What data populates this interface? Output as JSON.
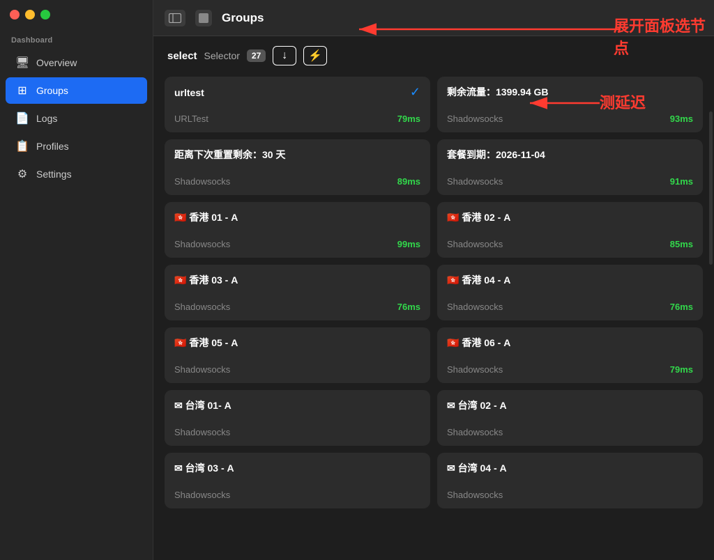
{
  "window": {
    "title": "Groups"
  },
  "traffic_lights": {
    "red": "red",
    "yellow": "yellow",
    "green": "green"
  },
  "sidebar": {
    "section_label": "Dashboard",
    "items": [
      {
        "id": "overview",
        "label": "Overview",
        "icon": "🖥",
        "active": false
      },
      {
        "id": "groups",
        "label": "Groups",
        "icon": "⊞",
        "active": true
      },
      {
        "id": "logs",
        "label": "Logs",
        "icon": "📄",
        "active": false
      },
      {
        "id": "profiles",
        "label": "Profiles",
        "icon": "📋",
        "active": false
      },
      {
        "id": "settings",
        "label": "Settings",
        "icon": "⚙",
        "active": false
      }
    ]
  },
  "titlebar": {
    "title": "Groups",
    "panel_icon": "⊞",
    "square_icon": "■"
  },
  "toolbar": {
    "select_label": "select",
    "selector_label": "Selector",
    "badge_count": "27",
    "download_btn_label": "↓",
    "lightning_btn_label": "⚡"
  },
  "annotations": {
    "panel_text": "展开面板选节点",
    "latency_text": "测延迟"
  },
  "nodes": [
    {
      "id": "node-urltest",
      "name": "urltest",
      "type": "URLTest",
      "latency": "79ms",
      "latency_color": "green",
      "selected": true,
      "flag": ""
    },
    {
      "id": "node-traffic",
      "name": "剩余流量：1399.94 GB",
      "type": "Shadowsocks",
      "latency": "93ms",
      "latency_color": "green",
      "selected": false,
      "flag": ""
    },
    {
      "id": "node-days",
      "name": "距离下次重置剩余：30 天",
      "type": "Shadowsocks",
      "latency": "89ms",
      "latency_color": "green",
      "selected": false,
      "flag": ""
    },
    {
      "id": "node-expire",
      "name": "套餐到期：2026-11-04",
      "type": "Shadowsocks",
      "latency": "91ms",
      "latency_color": "green",
      "selected": false,
      "flag": ""
    },
    {
      "id": "node-hk01",
      "name": "🇭🇰 香港 01 - A",
      "type": "Shadowsocks",
      "latency": "99ms",
      "latency_color": "green",
      "selected": false,
      "flag": "hk"
    },
    {
      "id": "node-hk02",
      "name": "🇭🇰 香港 02 - A",
      "type": "Shadowsocks",
      "latency": "85ms",
      "latency_color": "green",
      "selected": false,
      "flag": "hk"
    },
    {
      "id": "node-hk03",
      "name": "🇭🇰 香港 03 - A",
      "type": "Shadowsocks",
      "latency": "76ms",
      "latency_color": "green",
      "selected": false,
      "flag": "hk"
    },
    {
      "id": "node-hk04",
      "name": "🇭🇰 香港 04 - A",
      "type": "Shadowsocks",
      "latency": "76ms",
      "latency_color": "green",
      "selected": false,
      "flag": "hk"
    },
    {
      "id": "node-hk05",
      "name": "🇭🇰 香港 05 - A",
      "type": "Shadowsocks",
      "latency": "",
      "latency_color": "green",
      "selected": false,
      "flag": "hk"
    },
    {
      "id": "node-hk06",
      "name": "🇭🇰 香港 06 - A",
      "type": "Shadowsocks",
      "latency": "79ms",
      "latency_color": "green",
      "selected": false,
      "flag": "hk"
    },
    {
      "id": "node-tw01",
      "name": "✉ 台湾 01- A",
      "type": "Shadowsocks",
      "latency": "",
      "latency_color": "green",
      "selected": false,
      "flag": "tw"
    },
    {
      "id": "node-tw02",
      "name": "✉ 台湾 02 - A",
      "type": "Shadowsocks",
      "latency": "",
      "latency_color": "green",
      "selected": false,
      "flag": "tw"
    },
    {
      "id": "node-tw03",
      "name": "✉ 台湾 03 - A",
      "type": "Shadowsocks",
      "latency": "",
      "latency_color": "green",
      "selected": false,
      "flag": "tw"
    },
    {
      "id": "node-tw04",
      "name": "✉ 台湾 04 - A",
      "type": "Shadowsocks",
      "latency": "",
      "latency_color": "green",
      "selected": false,
      "flag": "tw"
    }
  ]
}
